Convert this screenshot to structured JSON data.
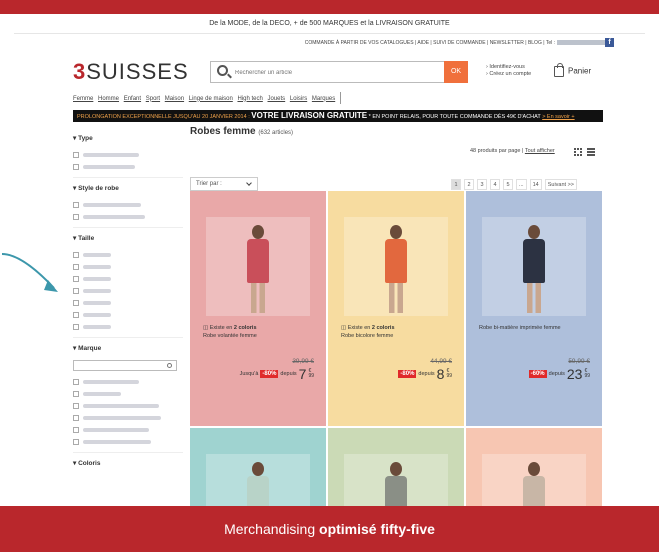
{
  "header": {
    "promo": "De la MODE, de la DECO, + de 500 MARQUES et la LIVRAISON GRATUITE",
    "util_links": "COMMANDE À PARTIR DE VOS CATALOGUES | AIDE | SUIVI DE COMMANDE | NEWSLETTER | BLOG | Tel :",
    "facebook": "f",
    "logo_number": "3",
    "logo_text": "SUISSES",
    "search_placeholder": "Rechercher un article",
    "search_button": "OK",
    "account_line1": "› Identifiez-vous",
    "account_line2": "› Créez un compte",
    "cart_label": "Panier"
  },
  "nav": [
    "Femme",
    "Homme",
    "Enfant",
    "Sport",
    "Maison",
    "Linge de maison",
    "High tech",
    "Jouets",
    "Loisirs",
    "Marques"
  ],
  "banner": {
    "part1": "PROLONGATION EXCEPTIONNELLE JUSQU'AU 20 JANVIER 2014 :",
    "part2": "VOTRE LIVRAISON GRATUITE",
    "part3": "* EN POINT RELAIS, POUR TOUTE COMMANDE DÈS 49€ D'ACHAT",
    "link": "> En savoir +"
  },
  "sidebar": {
    "type_title": "Type",
    "style_title": "Style de robe",
    "taille_title": "Taille",
    "marque_title": "Marque",
    "coloris_title": "Coloris"
  },
  "listing": {
    "title": "Robes femme",
    "count": "(632 articles)",
    "per_page": "48 produits par page |",
    "show_all": "Tout afficher",
    "sort_label": "Trier par :",
    "pages": [
      "1",
      "2",
      "3",
      "4",
      "5",
      "...",
      "14",
      "Suivant >>"
    ]
  },
  "products": [
    {
      "bg": "#e9a8a8",
      "dress": "#c94f5a",
      "colors_prefix": "Existe en",
      "colors": "2 coloris",
      "name": "Robe volantée femme",
      "old_price": "39,99 €",
      "prefix": "Jusqu'à",
      "discount": "-80%",
      "depuis": "depuis",
      "price": "7",
      "cents": "99",
      "currency": "€"
    },
    {
      "bg": "#f7dca0",
      "dress": "#e2683e",
      "colors_prefix": "Existe en",
      "colors": "2 coloris",
      "name": "Robe bicolore femme",
      "old_price": "44,99 €",
      "prefix": "",
      "discount": "-80%",
      "depuis": "depuis",
      "price": "8",
      "cents": "99",
      "currency": "€"
    },
    {
      "bg": "#aebfdb",
      "dress": "#2c3242",
      "colors_prefix": "",
      "colors": "",
      "name": "Robe bi-matière imprimée femme",
      "old_price": "59,99 €",
      "prefix": "",
      "discount": "-60%",
      "depuis": "depuis",
      "price": "23",
      "cents": "99",
      "currency": "€"
    },
    {
      "bg": "#9fd3d0",
      "dress": "#b8d3c8"
    },
    {
      "bg": "#cbdab6",
      "dress": "#8a8f86"
    },
    {
      "bg": "#f7c6b2",
      "dress": "#c8b6a6"
    }
  ],
  "footer": {
    "normal": "Merchandising",
    "bold": "optimisé fifty-five"
  },
  "colors": {
    "brand_red": "#b9272c",
    "arrow": "#3c97ab",
    "ok_orange": "#f0703c"
  }
}
